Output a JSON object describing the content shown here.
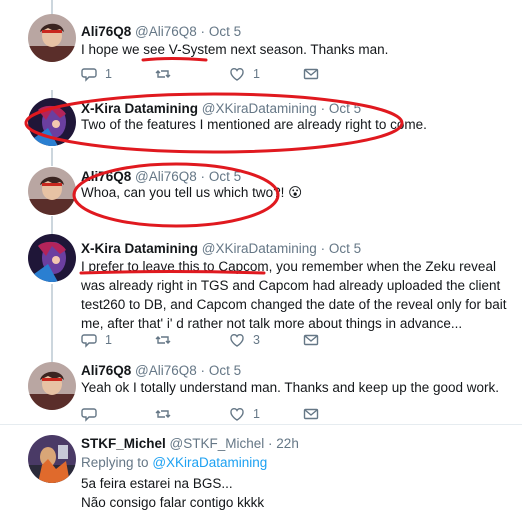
{
  "tweets": [
    {
      "name": "Ali76Q8",
      "handle": "@Ali76Q8",
      "date": "Oct 5",
      "text": "I hope we see V-System next season. Thanks man.",
      "reply_count": "1",
      "retweet_count": "",
      "like_count": "1"
    },
    {
      "name": "X-Kira Datamining",
      "handle": "@XKiraDatamining",
      "date": "Oct 5",
      "text": "Two of the features I mentioned are already right to come."
    },
    {
      "name": "Ali76Q8",
      "handle": "@Ali76Q8",
      "date": "Oct 5",
      "text": "Whoa, can you tell us which two?! 😮"
    },
    {
      "name": "X-Kira Datamining",
      "handle": "@XKiraDatamining",
      "date": "Oct 5",
      "text": "I prefer to leave this to Capcom, you remember when the Zeku reveal was already right in TGS and Capcom had already uploaded the client test260 to DB, and Capcom changed the date of the reveal only for bait me, after that' i' d rather not talk more about things in advance...",
      "reply_count": "1",
      "retweet_count": "",
      "like_count": "3"
    },
    {
      "name": "Ali76Q8",
      "handle": "@Ali76Q8",
      "date": "Oct 5",
      "text": "Yeah ok I totally understand man. Thanks and keep up the good work.",
      "reply_count": "",
      "retweet_count": "",
      "like_count": "1"
    },
    {
      "name": "STKF_Michel",
      "handle": "@STKF_Michel",
      "date": "22h",
      "replying_to_label": "Replying to",
      "replying_to_handle": "@XKiraDatamining",
      "text_line1": "5a feira estarei na BGS...",
      "text_line2": "Não consigo falar contigo kkkk"
    }
  ],
  "separator": "·",
  "colors": {
    "accent": "#1da1f2",
    "muted": "#657786",
    "thread_line": "#ccd6dd",
    "annotation": "#e0191f"
  }
}
